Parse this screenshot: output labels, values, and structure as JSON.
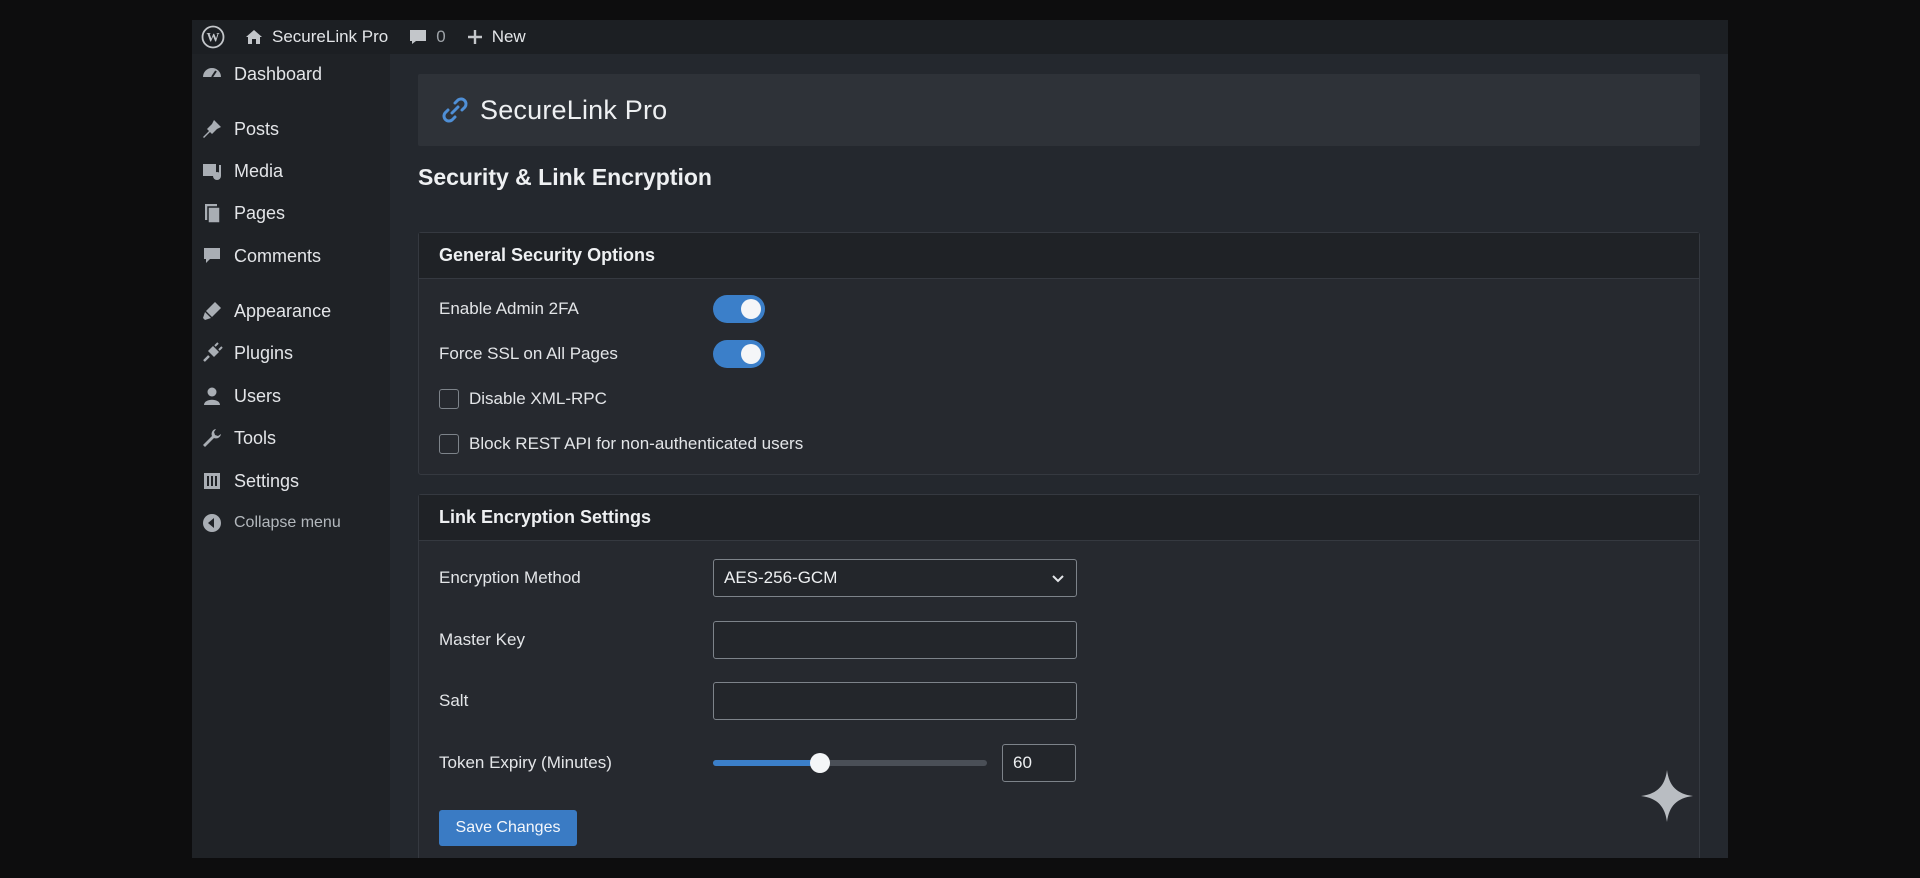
{
  "admin_bar": {
    "site_name": "SecureLink Pro",
    "comments_count": "0",
    "new_label": "New"
  },
  "sidebar": {
    "items": [
      {
        "label": "Dashboard",
        "icon": "dashboard-icon"
      },
      {
        "label": "Posts",
        "icon": "pin-icon"
      },
      {
        "label": "Media",
        "icon": "media-icon"
      },
      {
        "label": "Pages",
        "icon": "pages-icon"
      },
      {
        "label": "Comments",
        "icon": "comment-icon"
      },
      {
        "label": "Appearance",
        "icon": "paintbrush-icon"
      },
      {
        "label": "Plugins",
        "icon": "plug-icon"
      },
      {
        "label": "Users",
        "icon": "user-icon"
      },
      {
        "label": "Tools",
        "icon": "wrench-icon"
      },
      {
        "label": "Settings",
        "icon": "settings-icon"
      }
    ],
    "collapse_label": "Collapse menu"
  },
  "plugin": {
    "title": "SecureLink Pro",
    "icon": "link-icon"
  },
  "page_title": "Security & Link Encryption",
  "general": {
    "heading": "General Security Options",
    "toggles": [
      {
        "label": "Enable Admin 2FA",
        "on": true
      },
      {
        "label": "Force SSL on All Pages",
        "on": true
      }
    ],
    "checkboxes": [
      {
        "label": "Disable XML-RPC",
        "checked": false
      },
      {
        "label": "Block REST API for non-authenticated users",
        "checked": false
      }
    ]
  },
  "encryption": {
    "heading": "Link Encryption Settings",
    "method_label": "Encryption Method",
    "method_value": "AES-256-GCM",
    "master_key_label": "Master Key",
    "master_key_value": "",
    "salt_label": "Salt",
    "salt_value": "",
    "expiry_label": "Token Expiry (Minutes)",
    "expiry_value": "60",
    "expiry_slider_fraction": 0.39
  },
  "save_label": "Save Changes",
  "colors": {
    "accent": "#3b7fc9",
    "button": "#3a7bc4",
    "background": "#24282e"
  }
}
